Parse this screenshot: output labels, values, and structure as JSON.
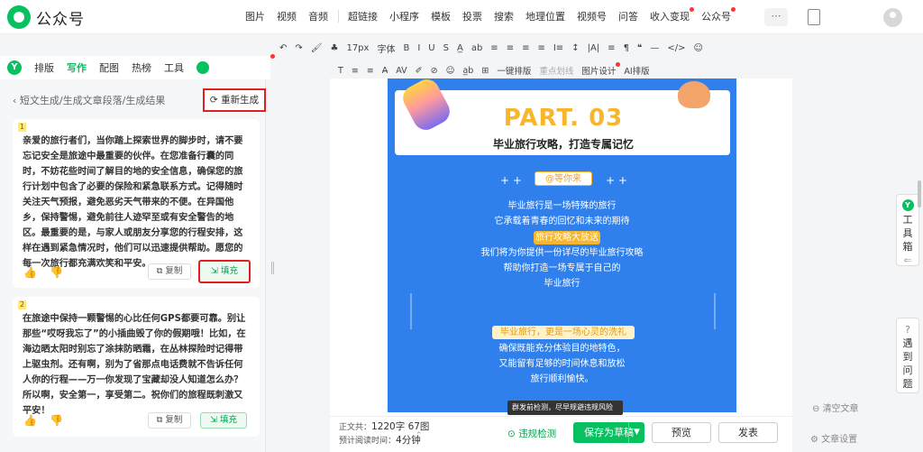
{
  "app": {
    "title": "公众号"
  },
  "topnav": [
    "图片",
    "视频",
    "音频",
    "超链接",
    "小程序",
    "模板",
    "投票",
    "搜索",
    "地理位置",
    "视频号",
    "问答",
    "收入变现",
    "公众号"
  ],
  "toolbar1": [
    "↶",
    "↷",
    "🖌",
    "♣",
    "17px",
    "字体",
    "B",
    "I",
    "U",
    "S",
    "A̲",
    "ab",
    "≡",
    "≡",
    "≡",
    "≡",
    "I≡",
    "↕",
    "|A|",
    "≡",
    "¶",
    "❝",
    "—",
    "</>",
    "☺"
  ],
  "toolbar2": [
    "T",
    "≡",
    "≡",
    "A̶",
    "AV",
    "✐",
    "⊘",
    "☺",
    "a̲b",
    "⊞",
    "一键排版",
    "重点划线",
    "图片设计",
    "AI排版"
  ],
  "tabs": [
    {
      "label": "排版"
    },
    {
      "label": "写作"
    },
    {
      "label": "配图"
    },
    {
      "label": "热榜"
    },
    {
      "label": "工具"
    }
  ],
  "breadcrumb": "短文生成/生成文章段落/生成结果",
  "regen_label": "重新生成",
  "results": [
    {
      "num": "1",
      "text": "亲爱的旅行者们，当你踏上探索世界的脚步时，请不要忘记安全是旅途中最重要的伙伴。在您准备行囊的同时，不妨花些时间了解目的地的安全信息，确保您的旅行计划中包含了必要的保险和紧急联系方式。记得随时关注天气预报，避免恶劣天气带来的不便。在异国他乡，保持警惕，避免前往人迹罕至或有安全警告的地区。最重要的是，与家人或朋友分享您的行程安排，这样在遇到紧急情况时，他们可以迅速提供帮助。愿您的每一次旅行都充满欢笑和平安。",
      "copy": "复制",
      "fill": "填充"
    },
    {
      "num": "2",
      "text": "在旅途中保持一颗警惕的心比任何GPS都要可靠。别让那些“哎呀我忘了”的小插曲毁了你的假期哦！比如，在海边晒太阳时别忘了涂抹防晒霜，在丛林探险时记得带上驱虫剂。还有啊，别为了省那点电话费就不告诉任何人你的行程——万一你发现了宝藏却没人知道怎么办？所以啊，安全第一，享受第二。祝你们的旅程既刺激又平安！",
      "copy": "复制",
      "fill": "填充"
    }
  ],
  "article": {
    "part": "PART. 03",
    "subtitle": "毕业旅行攻略，打造专属记忆",
    "tag1": "@等你来",
    "p1": [
      "毕业旅行是一场特殊的旅行",
      "它承载着青春的回忆和未来的期待"
    ],
    "tag2": "旅行攻略大放送",
    "p2": [
      "我们将为你提供一份详尽的毕业旅行攻略",
      "帮助你打造一场专属于自己的",
      "毕业旅行"
    ],
    "tag3": "毕业旅行，更是一场心灵的洗礼",
    "p3": [
      "确保既能充分体验目的地特色，",
      "又能留有足够的时间休息和放松",
      "旅行顺利愉快。"
    ],
    "stars": "+ +",
    "colors": {
      "bg": "#2f80ed",
      "accent": "#f7b62b"
    }
  },
  "tooltip": "群发前检测，尽早规避违规风险",
  "status": {
    "count_label": "正文共：",
    "count_value": "1220字 67图",
    "time_label": "预计阅读时间：",
    "time_value": "4分钟"
  },
  "violation_label": "违规检测",
  "save_label": "保存为草稿",
  "preview_label": "预览",
  "publish_label": "发表",
  "side": {
    "toolbox": "工具箱",
    "issue": "遇到问题",
    "clear": "清空文章",
    "settings": "文章设置"
  }
}
